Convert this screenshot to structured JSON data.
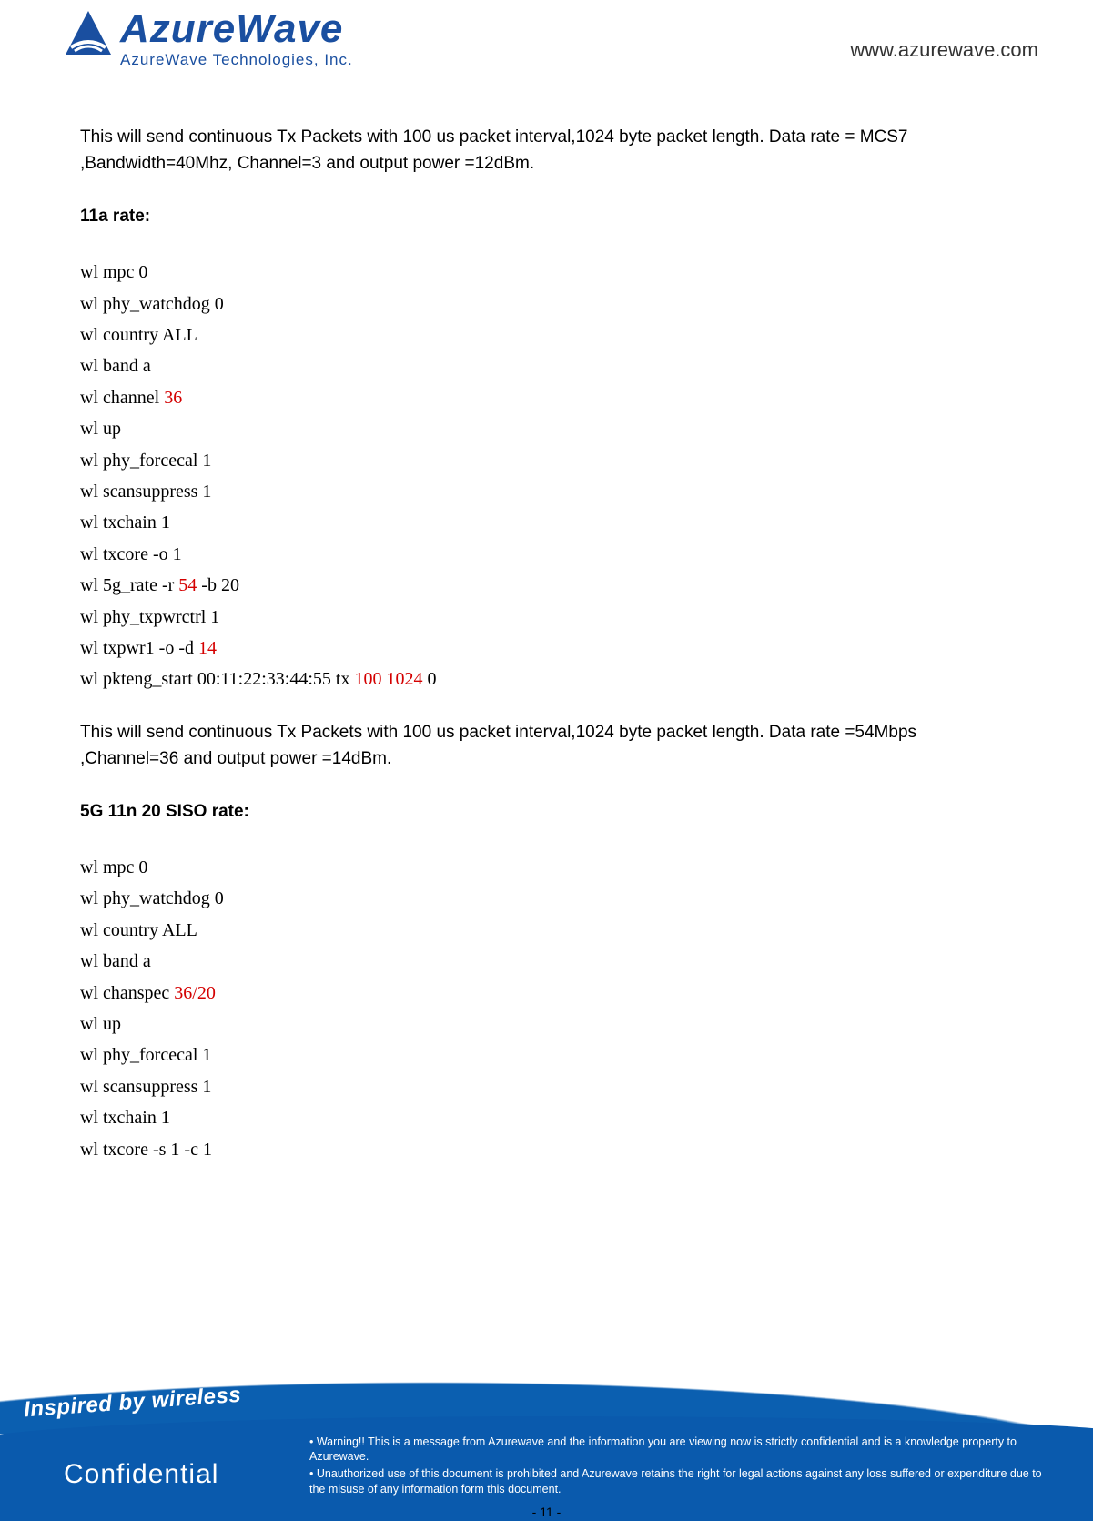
{
  "header": {
    "logo_main": "AzureWave",
    "logo_sub": "AzureWave  Technologies,  Inc.",
    "url": "www.azurewave.com"
  },
  "body": {
    "para1": "This will send continuous Tx Packets with 100 us packet interval,1024 byte packet length. Data rate = MCS7 ,Bandwidth=40Mhz, Channel=3 and output power =12dBm.",
    "section1_title": "11a rate:",
    "cmds1": {
      "l1": "wl mpc 0",
      "l2": "wl phy_watchdog 0",
      "l3": "wl country ALL",
      "l4": "wl band a",
      "l5a": "wl channel ",
      "l5b_red": "36",
      "l6": "wl up",
      "l7": "wl phy_forcecal 1",
      "l8": "wl scansuppress 1",
      "l9": "wl txchain 1",
      "l10": "wl txcore -o 1",
      "l11a": "wl 5g_rate -r ",
      "l11b_red": "54",
      "l11c": " -b 20",
      "l12": "wl phy_txpwrctrl 1",
      "l13a": "wl txpwr1 -o -d ",
      "l13b_red": "14",
      "l14a": "wl pkteng_start 00:11:22:33:44:55 tx ",
      "l14b_red": "100 1024",
      "l14c": " 0"
    },
    "para2": "This will send continuous Tx Packets with 100 us packet interval,1024 byte packet length. Data rate =54Mbps ,Channel=36 and output power =14dBm.",
    "section2_title": "5G 11n 20 SISO rate:",
    "cmds2": {
      "l1": "wl mpc 0",
      "l2": "wl phy_watchdog 0",
      "l3": "wl country ALL",
      "l4": "wl band a",
      "l5a": "wl chanspec ",
      "l5b_red": "36/20",
      "l6": "wl up",
      "l7": "wl phy_forcecal 1",
      "l8": "wl scansuppress 1",
      "l9": "wl txchain 1",
      "l10": "wl txcore -s 1 -c 1"
    }
  },
  "footer": {
    "inspired": "Inspired by wireless",
    "confidential": "Confidential",
    "warn1": "• Warning!! This is a message from Azurewave and the information you are viewing now is strictly confidential and is a knowledge property to Azurewave.",
    "warn2": "• Unauthorized use of this document is prohibited and Azurewave retains the right for legal actions against any loss suffered or expenditure due to the misuse of any information form this document.",
    "page": "- 11 -"
  }
}
